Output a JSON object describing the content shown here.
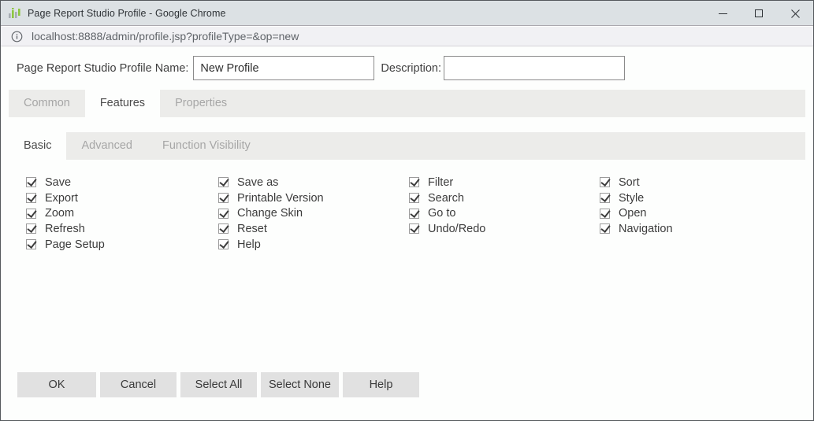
{
  "window": {
    "title": "Page Report Studio Profile - Google Chrome"
  },
  "url_bar": {
    "url": "localhost:8888/admin/profile.jsp?profileType=&op=new"
  },
  "form": {
    "name_label": "Page Report Studio Profile Name:",
    "name_value": "New Profile",
    "description_label": "Description:",
    "description_value": ""
  },
  "tabs": [
    {
      "label": "Common",
      "active": false
    },
    {
      "label": "Features",
      "active": true
    },
    {
      "label": "Properties",
      "active": false
    }
  ],
  "subtabs": [
    {
      "label": "Basic",
      "active": true
    },
    {
      "label": "Advanced",
      "active": false
    },
    {
      "label": "Function Visibility",
      "active": false
    }
  ],
  "features": {
    "columns": [
      {
        "items": [
          {
            "label": "Save",
            "checked": true
          },
          {
            "label": "Export",
            "checked": true
          },
          {
            "label": "Zoom",
            "checked": true
          },
          {
            "label": "Refresh",
            "checked": true
          },
          {
            "label": "Page Setup",
            "checked": true
          }
        ]
      },
      {
        "items": [
          {
            "label": "Save as",
            "checked": true
          },
          {
            "label": "Printable Version",
            "checked": true
          },
          {
            "label": "Change Skin",
            "checked": true
          },
          {
            "label": "Reset",
            "checked": true
          },
          {
            "label": "Help",
            "checked": true
          }
        ]
      },
      {
        "items": [
          {
            "label": "Filter",
            "checked": true
          },
          {
            "label": "Search",
            "checked": true
          },
          {
            "label": "Go to",
            "checked": true
          },
          {
            "label": "Undo/Redo",
            "checked": true
          }
        ]
      },
      {
        "items": [
          {
            "label": "Sort",
            "checked": true
          },
          {
            "label": "Style",
            "checked": true
          },
          {
            "label": "Open",
            "checked": true
          },
          {
            "label": "Navigation",
            "checked": true
          }
        ]
      }
    ]
  },
  "action_buttons": [
    "OK",
    "Cancel",
    "Select All",
    "Select None",
    "Help"
  ],
  "icons": {
    "app_icon": "equalizer-bars-icon",
    "url_icon": "info-icon"
  },
  "colors": {
    "accent_green": "#8dc63f",
    "title_bar_bg": "#dce1e4",
    "url_bar_bg": "#f1f1f4",
    "tab_strip_bg": "#ececea",
    "button_bg": "#e1e1e1"
  }
}
